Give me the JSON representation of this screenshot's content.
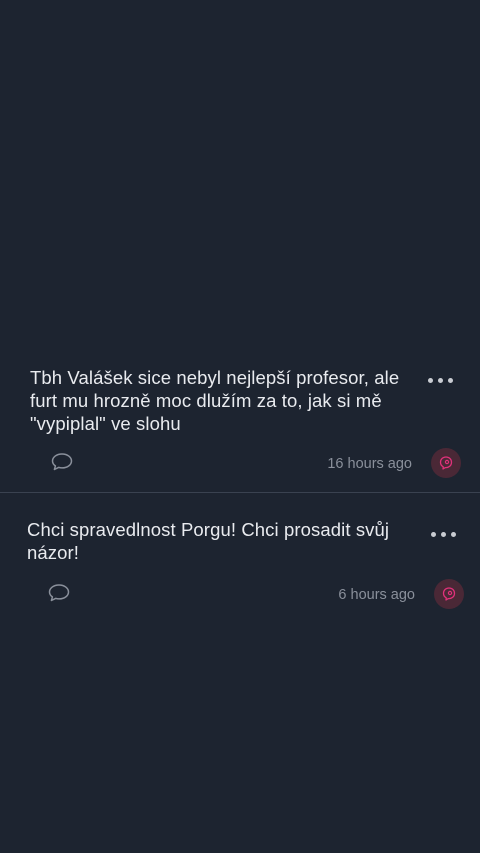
{
  "posts": [
    {
      "text": "Tbh Valášek sice nebyl nejlepší profesor, ale furt mu hrozně moc dlužím za to, jak si mě \"vypiplal\" ve slohu",
      "timestamp": "16 hours ago",
      "more_icon": "more-horizontal-icon",
      "comment_icon": "comment-bubble-icon",
      "avatar_icon": "avatar-icon"
    },
    {
      "text": "Chci spravedlnost Porgu! Chci prosadit svůj názor!",
      "timestamp": "6 hours ago",
      "more_icon": "more-horizontal-icon",
      "comment_icon": "comment-bubble-icon",
      "avatar_icon": "avatar-icon"
    }
  ],
  "colors": {
    "background": "#1d2430",
    "text": "#e9ebef",
    "muted": "#8a909b",
    "avatar_bg": "#4a2836",
    "avatar_accent": "#e0317a",
    "divider": "#3a4250"
  }
}
